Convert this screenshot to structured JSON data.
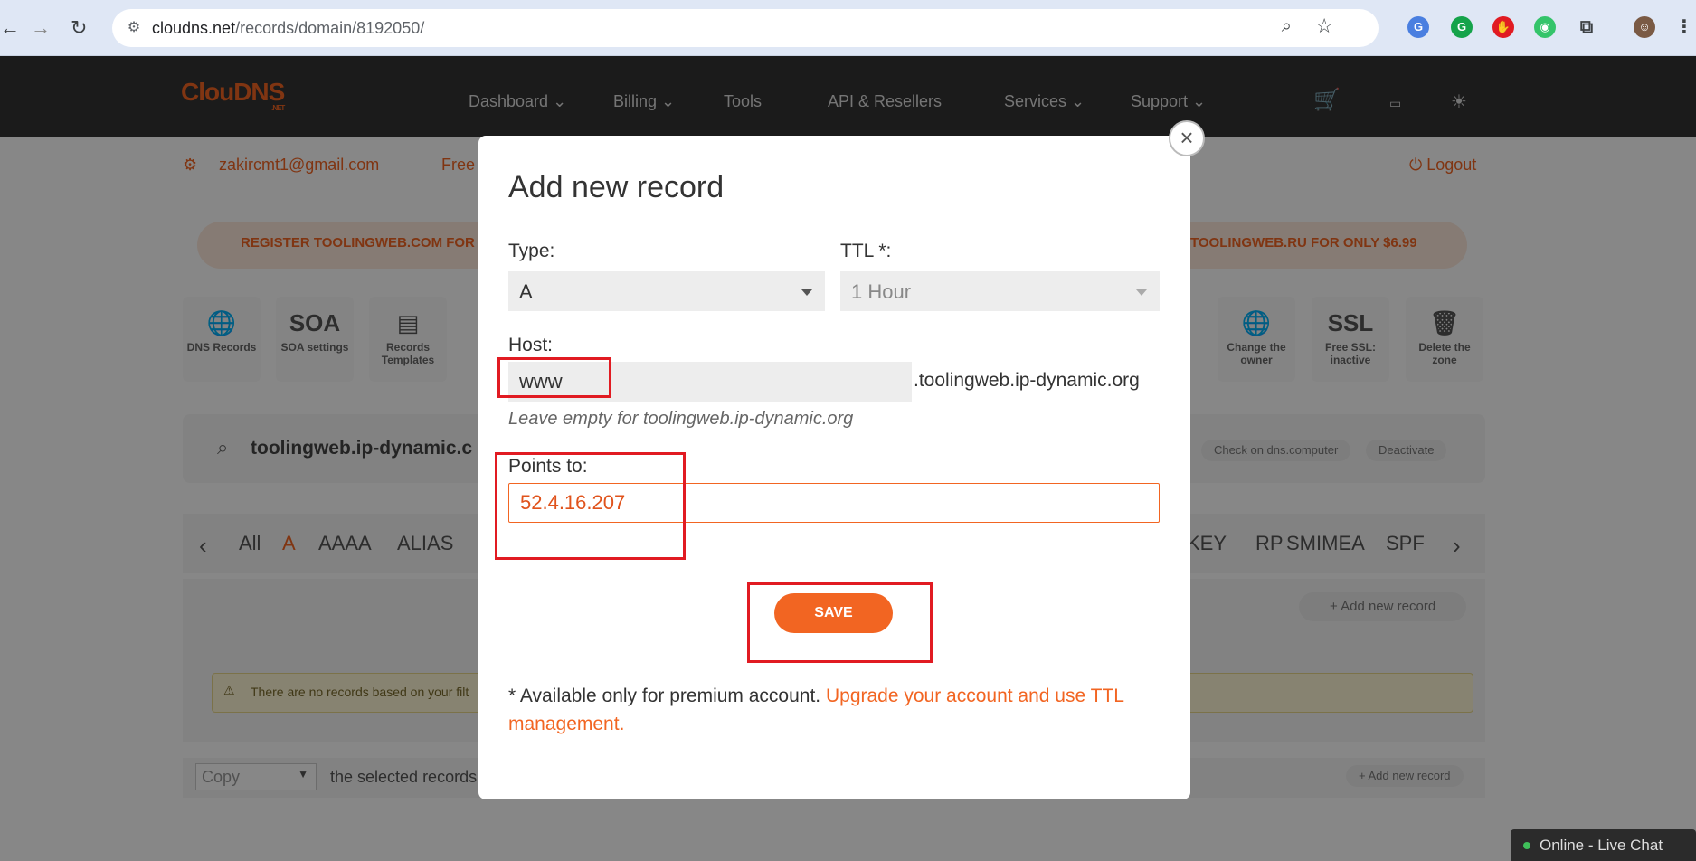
{
  "browser": {
    "url_domain": "cloudns.net",
    "url_path": "/records/domain/8192050/"
  },
  "site": {
    "logo": "ClouDNS",
    "logo_sub": ".NET",
    "nav": [
      "Dashboard",
      "Billing",
      "Tools",
      "API & Resellers",
      "Services",
      "Support"
    ],
    "user_email": "zakircmt1@gmail.com",
    "user_plan_partial": "Free",
    "logout": "Logout",
    "promo_left": "REGISTER TOOLINGWEB.COM FOR",
    "promo_right": "TOOLINGWEB.RU FOR ONLY $6.99",
    "tools_left": [
      {
        "icon": "globe-icon",
        "glyph": "🌐",
        "label": "DNS Records"
      },
      {
        "icon": "soa-icon",
        "glyph": "SOA",
        "label": "SOA settings"
      },
      {
        "icon": "template-icon",
        "glyph": "▤",
        "label": "Records Templates"
      }
    ],
    "tools_right": [
      {
        "icon": "transfer-icon",
        "glyph": "🌐",
        "label": "Change the owner"
      },
      {
        "icon": "ssl-shield-icon",
        "glyph": "SSL",
        "label": "Free SSL: inactive"
      },
      {
        "icon": "trash-icon",
        "glyph": "🗑",
        "label": "Delete the zone"
      }
    ],
    "zone_name": "toolingweb.ip-dynamic.c",
    "check_on": "Check on dns.computer",
    "deactivate": "Deactivate",
    "types_left": [
      "All",
      "A",
      "AAAA",
      "ALIAS"
    ],
    "types_right": [
      "KEY",
      "RP",
      "SMIMEA",
      "SPF"
    ],
    "add_new_record": "+ Add new record",
    "no_records_warning": "There are no records based on your filt",
    "copy_select": "Copy",
    "selected_records": "the selected records",
    "add_new_record_small": "+ Add new record",
    "chat": "Online - Live Chat"
  },
  "modal": {
    "title": "Add new record",
    "type_label": "Type:",
    "type_value": "A",
    "ttl_label": "TTL *:",
    "ttl_value": "1 Hour",
    "host_label": "Host:",
    "host_value": "www",
    "host_suffix": ".toolingweb.ip-dynamic.org",
    "host_hint": "Leave empty for toolingweb.ip-dynamic.org",
    "points_label": "Points to:",
    "points_value": "52.4.16.207",
    "save": "SAVE",
    "note_text": "* Available only for premium account. ",
    "note_link": "Upgrade your account and use TTL management."
  },
  "colors": {
    "brand_orange": "#f26522",
    "highlight_red": "#e11b22"
  }
}
